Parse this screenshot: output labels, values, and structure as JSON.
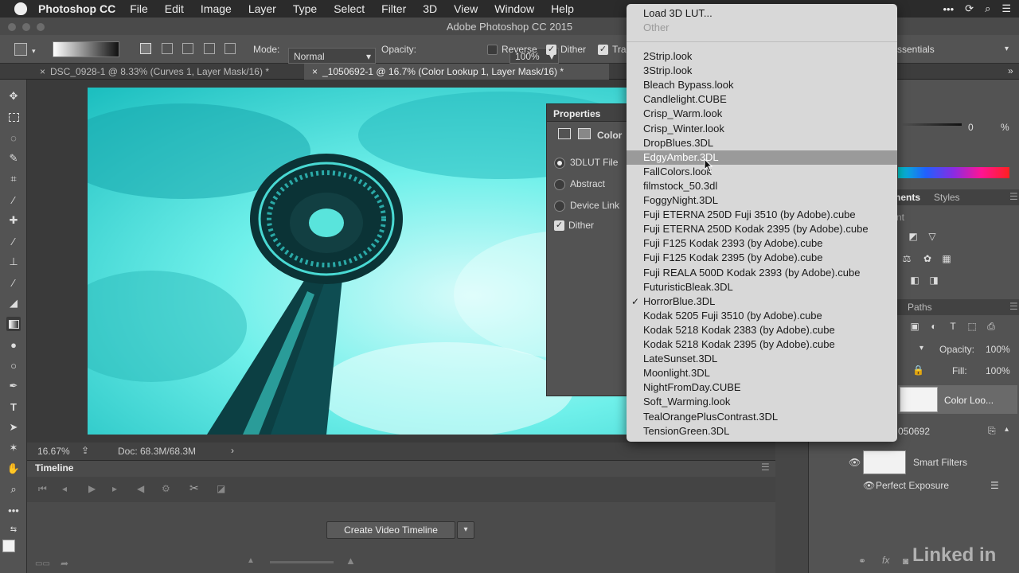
{
  "menubar": {
    "app_name": "Photoshop CC",
    "items": [
      "File",
      "Edit",
      "Image",
      "Layer",
      "Type",
      "Select",
      "Filter",
      "3D",
      "View",
      "Window",
      "Help"
    ]
  },
  "titlebar": {
    "title": "Adobe Photoshop CC 2015"
  },
  "options": {
    "mode_label": "Mode:",
    "mode_value": "Normal",
    "opacity_label": "Opacity:",
    "opacity_value": "100%",
    "reverse_label": "Reverse",
    "dither_label": "Dither",
    "transparency_label": "Tra",
    "workspace_value": "ssentials"
  },
  "tabs": [
    {
      "label": "DSC_0928-1 @ 8.33% (Curves 1, Layer Mask/16) *"
    },
    {
      "label": "_1050692-1 @ 16.7% (Color Lookup 1, Layer Mask/16) *"
    }
  ],
  "status": {
    "zoom": "16.67%",
    "doc": "Doc: 68.3M/68.3M"
  },
  "timeline": {
    "title": "Timeline",
    "create_button": "Create Video Timeline"
  },
  "properties": {
    "title": "Properties",
    "subtitle": "Color",
    "options": [
      "3DLUT File",
      "Abstract",
      "Device Link"
    ],
    "dither_label": "Dither"
  },
  "dropdown": {
    "load_item": "Load 3D LUT...",
    "other_item": "Other",
    "items": [
      "2Strip.look",
      "3Strip.look",
      "Bleach Bypass.look",
      "Candlelight.CUBE",
      "Crisp_Warm.look",
      "Crisp_Winter.look",
      "DropBlues.3DL",
      "EdgyAmber.3DL",
      "FallColors.look",
      "filmstock_50.3dl",
      "FoggyNight.3DL",
      "Fuji ETERNA 250D Fuji 3510 (by Adobe).cube",
      "Fuji ETERNA 250D Kodak 2395 (by Adobe).cube",
      "Fuji F125 Kodak 2393 (by Adobe).cube",
      "Fuji F125 Kodak 2395 (by Adobe).cube",
      "Fuji REALA 500D Kodak 2393 (by Adobe).cube",
      "FuturisticBleak.3DL",
      "HorrorBlue.3DL",
      "Kodak 5205 Fuji 3510 (by Adobe).cube",
      "Kodak 5218 Kodak 2383 (by Adobe).cube",
      "Kodak 5218 Kodak 2395 (by Adobe).cube",
      "LateSunset.3DL",
      "Moonlight.3DL",
      "NightFromDay.CUBE",
      "Soft_Warming.look",
      "TealOrangePlusContrast.3DL",
      "TensionGreen.3DL"
    ],
    "highlighted": "EdgyAmber.3DL",
    "checked": "HorrorBlue.3DL"
  },
  "right": {
    "adjust_value": "0",
    "adjust_unit": "%",
    "tab_adjustments": "nents",
    "tab_styles": "Styles",
    "tab_paths": "Paths",
    "nt_label": "nt",
    "opacity_label": "Opacity:",
    "opacity_value": "100%",
    "fill_label": "Fill:",
    "fill_value": "100%",
    "layer_color_lookup": "Color Loo...",
    "layer_name": "050692",
    "smart_filters": "Smart Filters",
    "perfect_exposure": "Perfect Exposure",
    "watermark": "Linked in"
  },
  "colors": {
    "accent_cyan": "#2fd6d2",
    "menu_bg": "#d8d8d8",
    "highlight": "#9a9a9a"
  }
}
